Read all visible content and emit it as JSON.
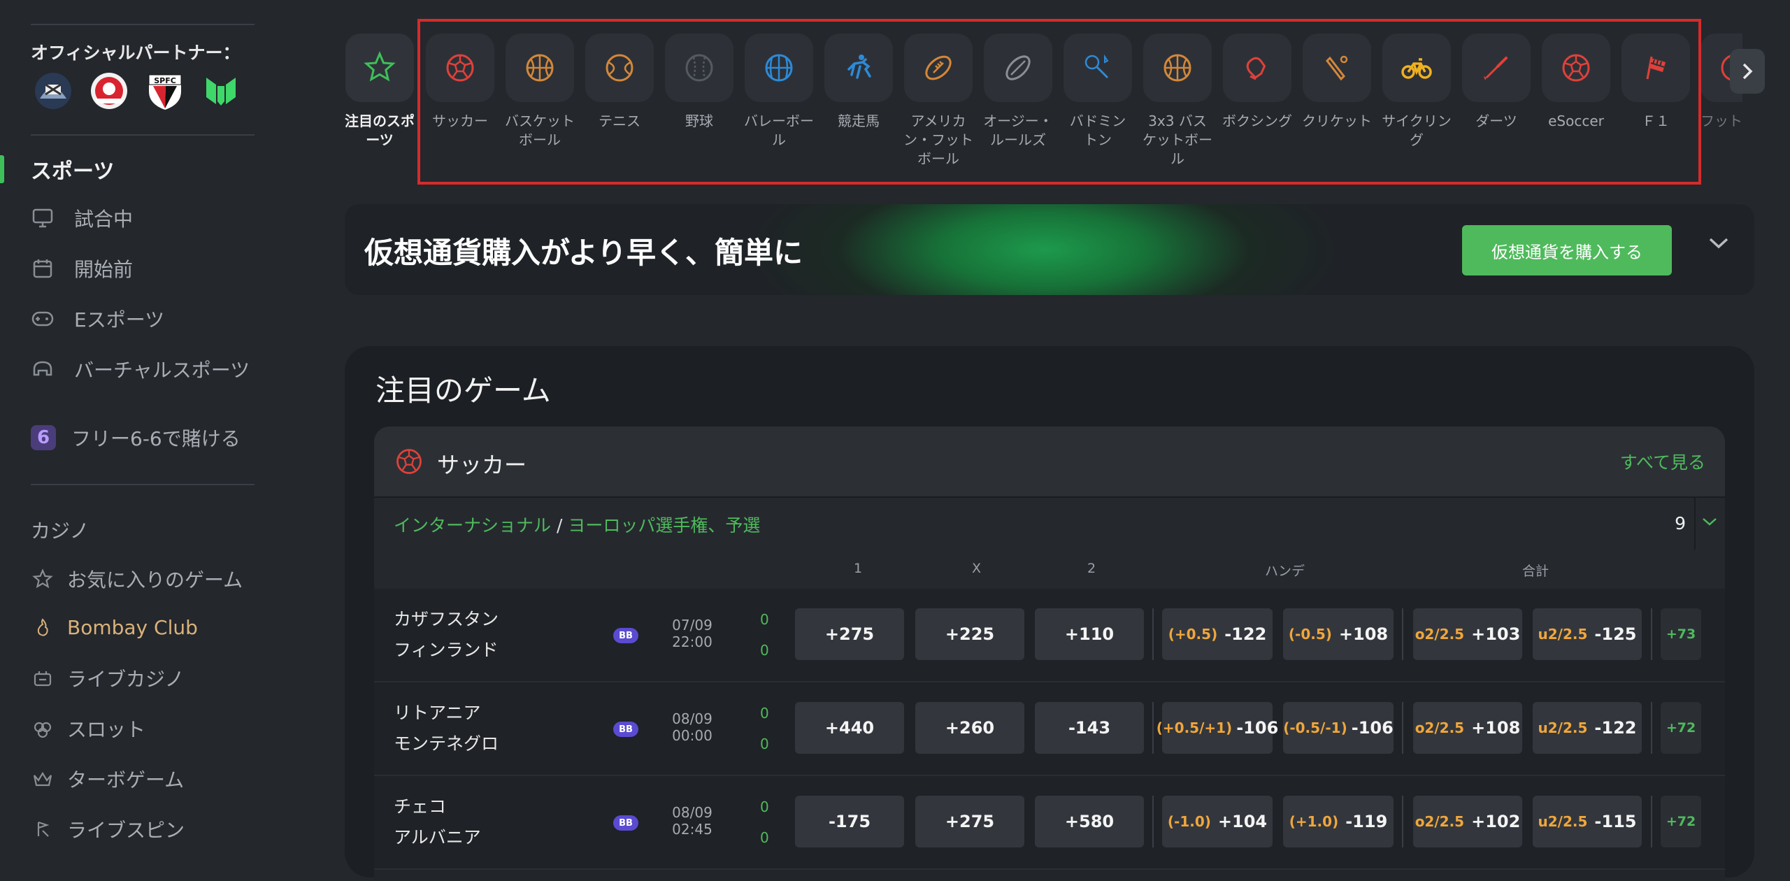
{
  "sidebar": {
    "partner_title": "オフィシャルパートナー：",
    "partners": [
      "newcastle-crest",
      "southampton-crest",
      "spfc-crest",
      "esports-logo"
    ],
    "sports_header": "スポーツ",
    "nav": [
      {
        "icon": "monitor-icon",
        "label": "試合中"
      },
      {
        "icon": "calendar-icon",
        "label": "開始前"
      },
      {
        "icon": "gamepad-icon",
        "label": "Eスポーツ"
      },
      {
        "icon": "vr-headset-icon",
        "label": "バーチャルスポーツ"
      }
    ],
    "free_bet": {
      "badge": "6",
      "label": "フリー6-6で賭ける"
    },
    "casino_header": "カジノ",
    "casino": [
      {
        "icon": "star-icon",
        "label": "お気に入りのゲーム"
      },
      {
        "icon": "flame-icon",
        "label": "Bombay Club"
      },
      {
        "icon": "live-casino-icon",
        "label": "ライブカジノ"
      },
      {
        "icon": "slot-icon",
        "label": "スロット"
      },
      {
        "icon": "crown-icon",
        "label": "ターボゲーム"
      },
      {
        "icon": "spin-icon",
        "label": "ライブスピン"
      }
    ]
  },
  "sports_strip": {
    "featured": {
      "label": "注目のスポーツ",
      "icon": "star-icon"
    },
    "items": [
      {
        "label": "サッカー",
        "icon": "soccer-ball-icon",
        "color": "#e0413a"
      },
      {
        "label": "バスケットボール",
        "icon": "basketball-icon",
        "color": "#d4873a"
      },
      {
        "label": "テニス",
        "icon": "tennis-ball-icon",
        "color": "#d4873a"
      },
      {
        "label": "野球",
        "icon": "baseball-icon",
        "color": "#555a61"
      },
      {
        "label": "バレーボール",
        "icon": "volleyball-icon",
        "color": "#2d8ad8"
      },
      {
        "label": "競走馬",
        "icon": "horse-racing-icon",
        "color": "#2d8ad8"
      },
      {
        "label": "アメリカン・フットボール",
        "icon": "american-football-icon",
        "color": "#d4873a"
      },
      {
        "label": "オージー・ルールズ",
        "icon": "aussie-rules-icon",
        "color": "#8a8f96"
      },
      {
        "label": "バドミントン",
        "icon": "badminton-icon",
        "color": "#2d8ad8"
      },
      {
        "label": "3x3 バスケットボール",
        "icon": "basketball-3x3-icon",
        "color": "#d4873a"
      },
      {
        "label": "ボクシング",
        "icon": "boxing-glove-icon",
        "color": "#e0413a"
      },
      {
        "label": "クリケット",
        "icon": "cricket-bat-icon",
        "color": "#d4873a"
      },
      {
        "label": "サイクリング",
        "icon": "bicycle-icon",
        "color": "#f0b020"
      },
      {
        "label": "ダーツ",
        "icon": "dart-icon",
        "color": "#e0413a"
      },
      {
        "label": "eSoccer",
        "icon": "esoccer-icon",
        "color": "#e0413a"
      },
      {
        "label": "Ｆ１",
        "icon": "checkered-flag-icon",
        "color": "#e0413a"
      },
      {
        "label": "フット",
        "icon": "futsal-icon",
        "color": "#e0413a"
      }
    ]
  },
  "banner": {
    "title": "仮想通貨購入がより早く、簡単に",
    "button": "仮想通貨を購入する"
  },
  "featured_games": {
    "title": "注目のゲーム",
    "sport": "サッカー",
    "see_all": "すべて見る",
    "league_region": "インターナショナル",
    "league_sep": "/",
    "league_name": "ヨーロッパ選手権、予選",
    "league_count": "9",
    "columns": {
      "one": "1",
      "x": "X",
      "two": "2",
      "handicap": "ハンデ",
      "total": "合計"
    },
    "matches": [
      {
        "home": "カザフスタン",
        "away": "フィンランド",
        "badge": "BB",
        "date": "07/09",
        "time": "22:00",
        "score_home": "0",
        "score_away": "0",
        "odds": [
          "+275",
          "+225",
          "+110"
        ],
        "hcp": [
          {
            "line": "(+0.5)",
            "price": "-122"
          },
          {
            "line": "(-0.5)",
            "price": "+108"
          }
        ],
        "tot": [
          {
            "line": "o2/2.5",
            "price": "+103"
          },
          {
            "line": "u2/2.5",
            "price": "-125"
          }
        ],
        "more": "+73"
      },
      {
        "home": "リトアニア",
        "away": "モンテネグロ",
        "badge": "BB",
        "date": "08/09",
        "time": "00:00",
        "score_home": "0",
        "score_away": "0",
        "odds": [
          "+440",
          "+260",
          "-143"
        ],
        "hcp": [
          {
            "line": "(+0.5/+1)",
            "price": "-106"
          },
          {
            "line": "(-0.5/-1)",
            "price": "-106"
          }
        ],
        "tot": [
          {
            "line": "o2/2.5",
            "price": "+108"
          },
          {
            "line": "u2/2.5",
            "price": "-122"
          }
        ],
        "more": "+72"
      },
      {
        "home": "チェコ",
        "away": "アルバニア",
        "badge": "BB",
        "date": "08/09",
        "time": "02:45",
        "score_home": "0",
        "score_away": "0",
        "odds": [
          "-175",
          "+275",
          "+580"
        ],
        "hcp": [
          {
            "line": "(-1.0)",
            "price": "+104"
          },
          {
            "line": "(+1.0)",
            "price": "-119"
          }
        ],
        "tot": [
          {
            "line": "o2/2.5",
            "price": "+102"
          },
          {
            "line": "u2/2.5",
            "price": "-115"
          }
        ],
        "more": "+72"
      }
    ]
  },
  "colors": {
    "accent": "#4fba5c",
    "handicap_line": "#f0a63c",
    "highlight_box": "#d62b2b"
  }
}
